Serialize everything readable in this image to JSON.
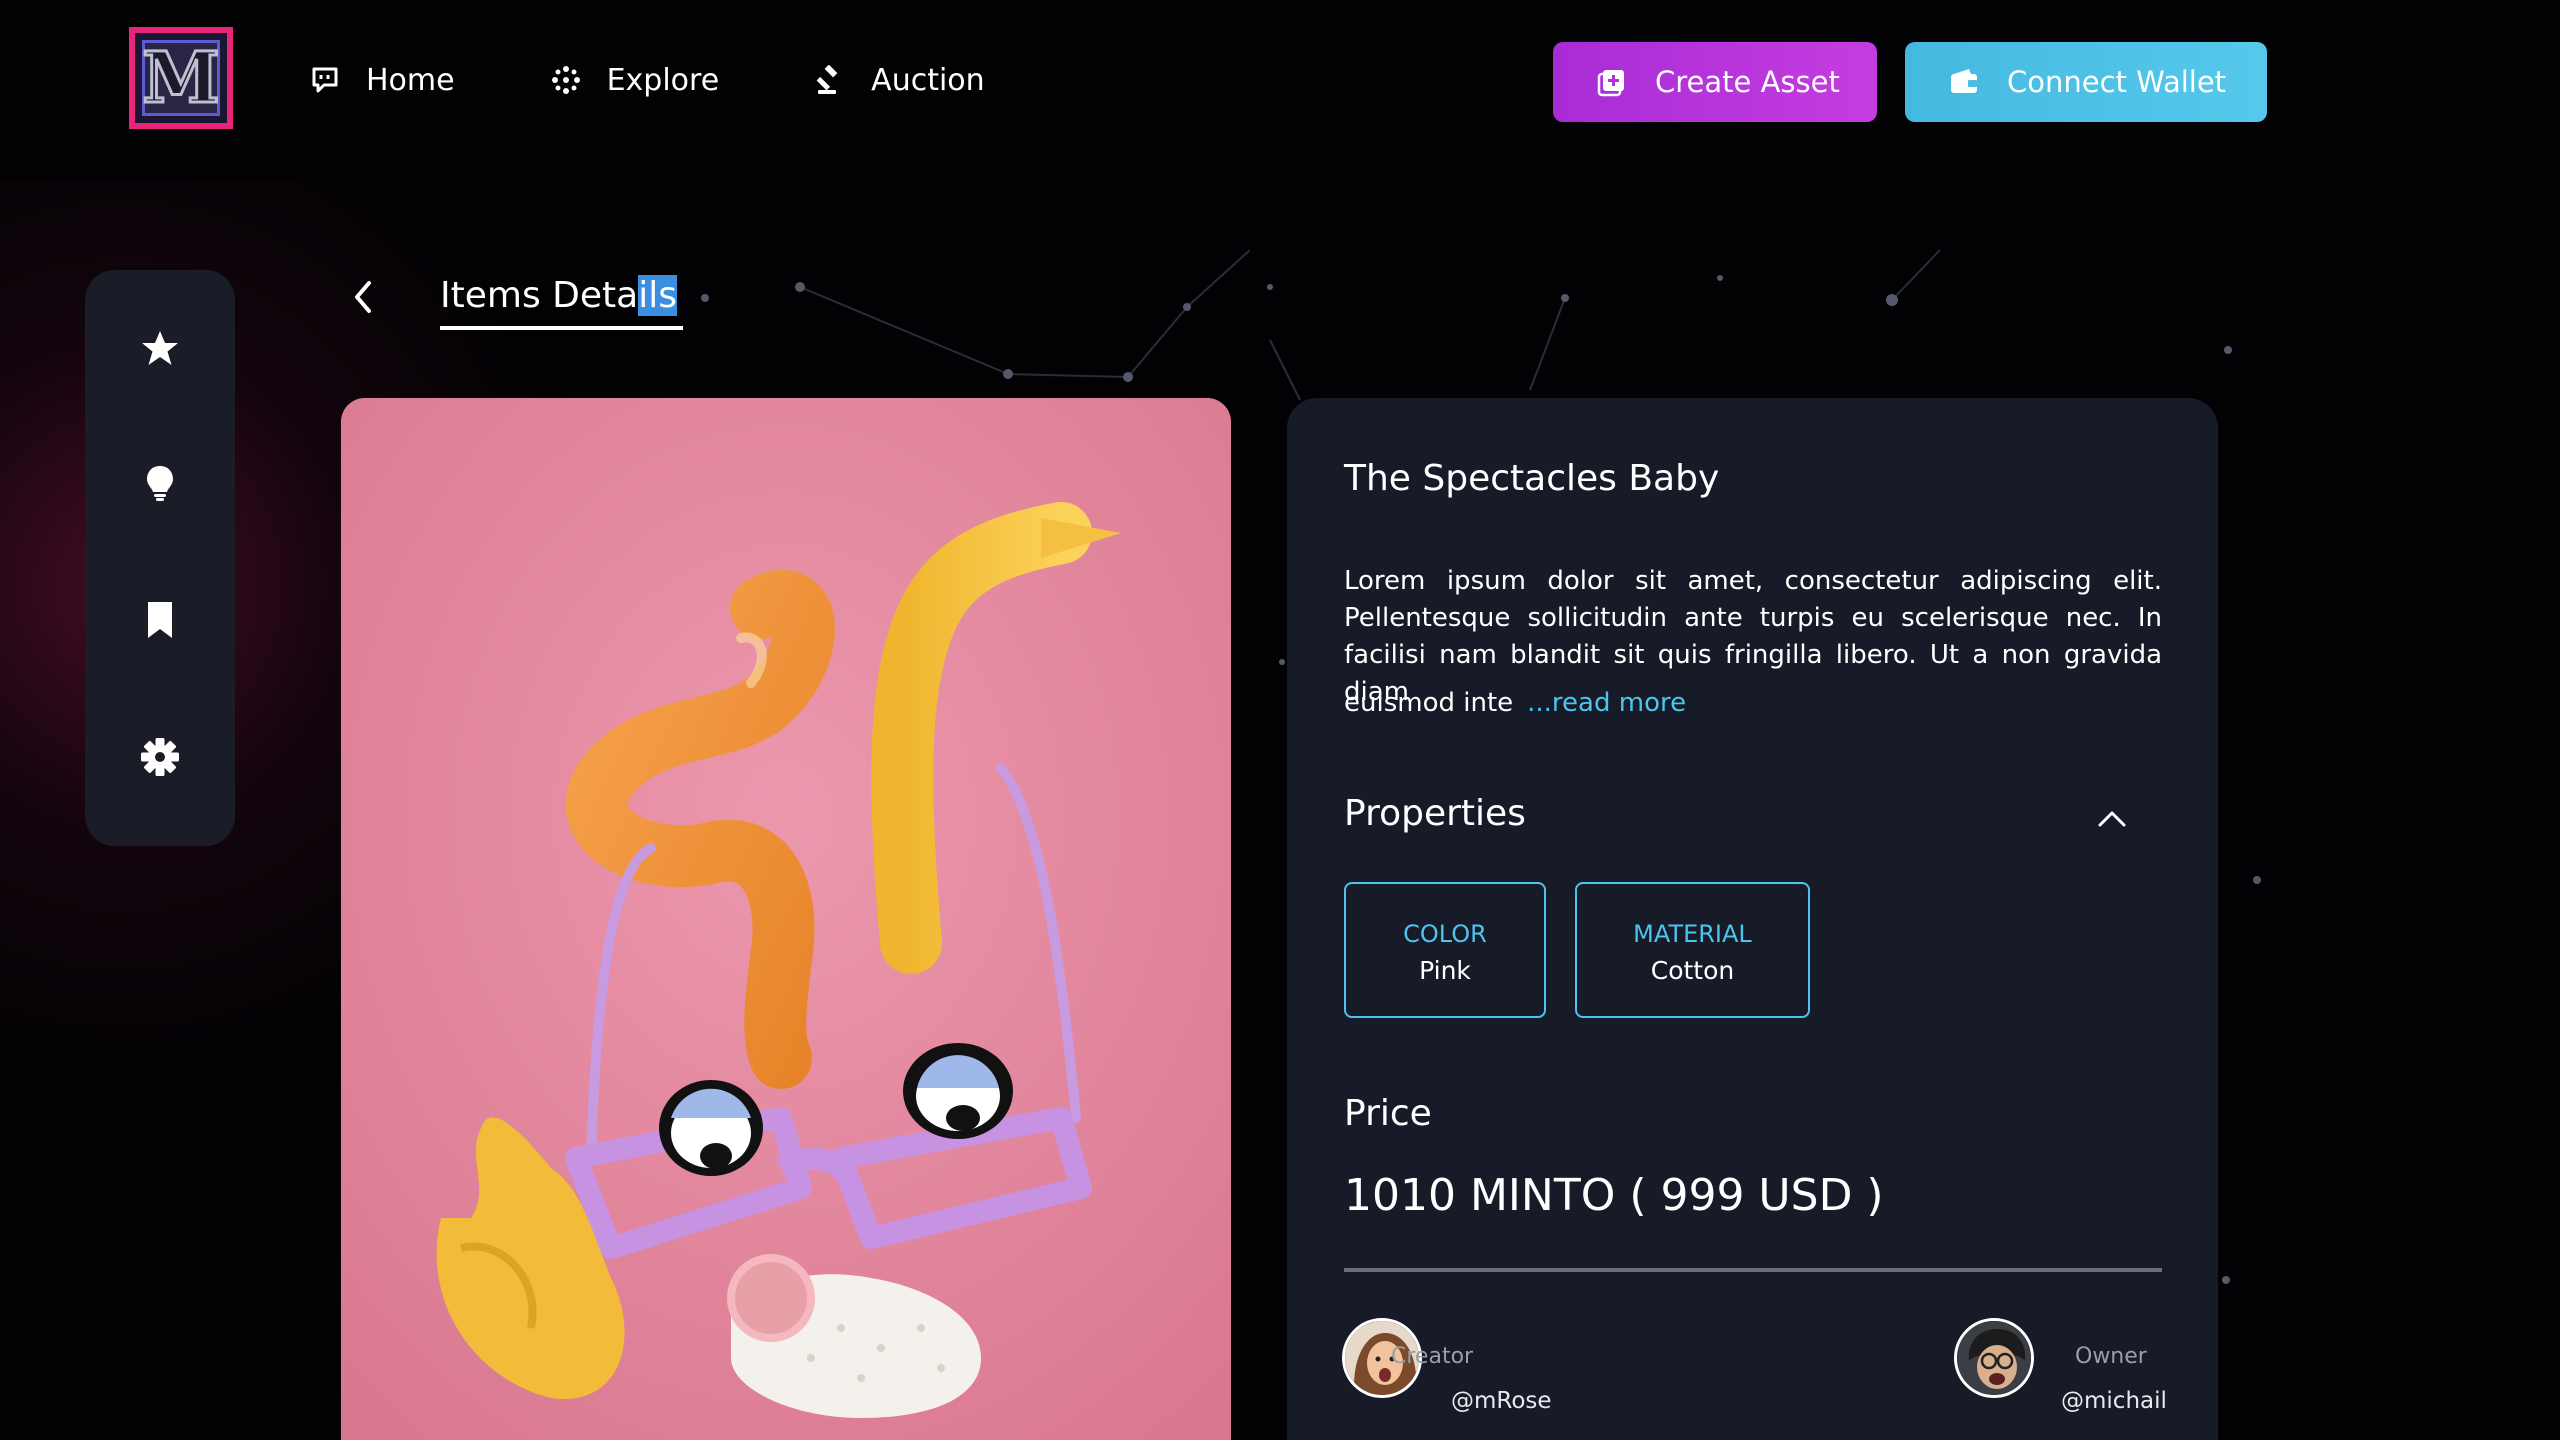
{
  "nav": {
    "items": [
      {
        "label": "Home",
        "icon": "chat-bubble-icon"
      },
      {
        "label": "Explore",
        "icon": "explore-dots-icon"
      },
      {
        "label": "Auction",
        "icon": "gavel-icon"
      }
    ],
    "create_label": "Create Asset",
    "wallet_label": "Connect Wallet"
  },
  "sidebar": {
    "items": [
      "star-icon",
      "lightbulb-icon",
      "bookmark-icon",
      "gear-icon"
    ]
  },
  "header": {
    "title_main": "Items Deta",
    "title_highlight": "ils"
  },
  "item": {
    "name": "The Spectacles Baby",
    "description": "Lorem ipsum dolor sit amet, consectetur adipiscing elit. Pellentesque sollicitudin ante turpis eu scelerisque nec. In facilisi nam blandit sit quis fringilla libero. Ut a non gravida diam",
    "description_tail": "euismod inte",
    "read_more": "...read more"
  },
  "properties": {
    "title": "Properties",
    "items": [
      {
        "key": "COLOR",
        "value": "Pink"
      },
      {
        "key": "MATERIAL",
        "value": "Cotton"
      }
    ]
  },
  "price": {
    "title": "Price",
    "value": "1010 MINTO ( 999 USD )"
  },
  "people": {
    "creator_label": "Creator",
    "creator_handle": "@mRose",
    "owner_label": "Owner",
    "owner_handle": "@michail"
  },
  "colors": {
    "accent_blue": "#4cc4ef",
    "accent_purple": "#b533dc",
    "panel_bg": "#161b27",
    "logo_border": "#e8257a"
  }
}
